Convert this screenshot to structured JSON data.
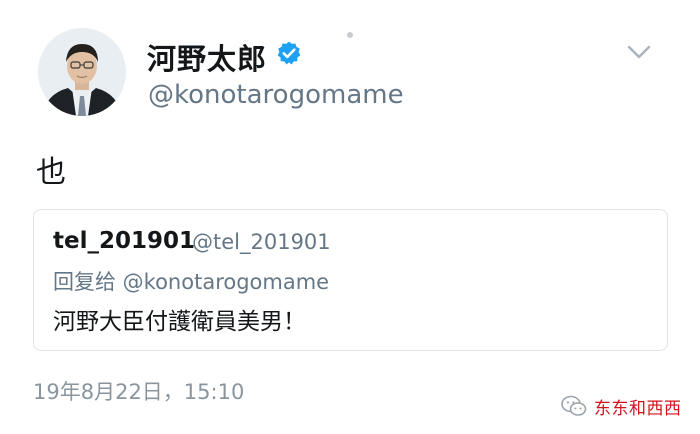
{
  "tweet": {
    "display_name": "河野太郎",
    "handle": "@konotarogomame",
    "verified": true,
    "text": "也",
    "timestamp": "19年8月22日，15:10",
    "menu_icon": "chevron-down-icon"
  },
  "quoted_tweet": {
    "display_name": "tel_201901",
    "handle": "@tel_201901",
    "reply_to": "回复给 @konotarogomame",
    "text": "河野大臣付護衛員美男！"
  },
  "watermark": {
    "text": "东东和西西",
    "icon": "wechat-icon",
    "color": "#d3121b"
  },
  "colors": {
    "verified_badge": "#1da1f2",
    "secondary_text": "#657786",
    "border": "#dfe3e7"
  }
}
